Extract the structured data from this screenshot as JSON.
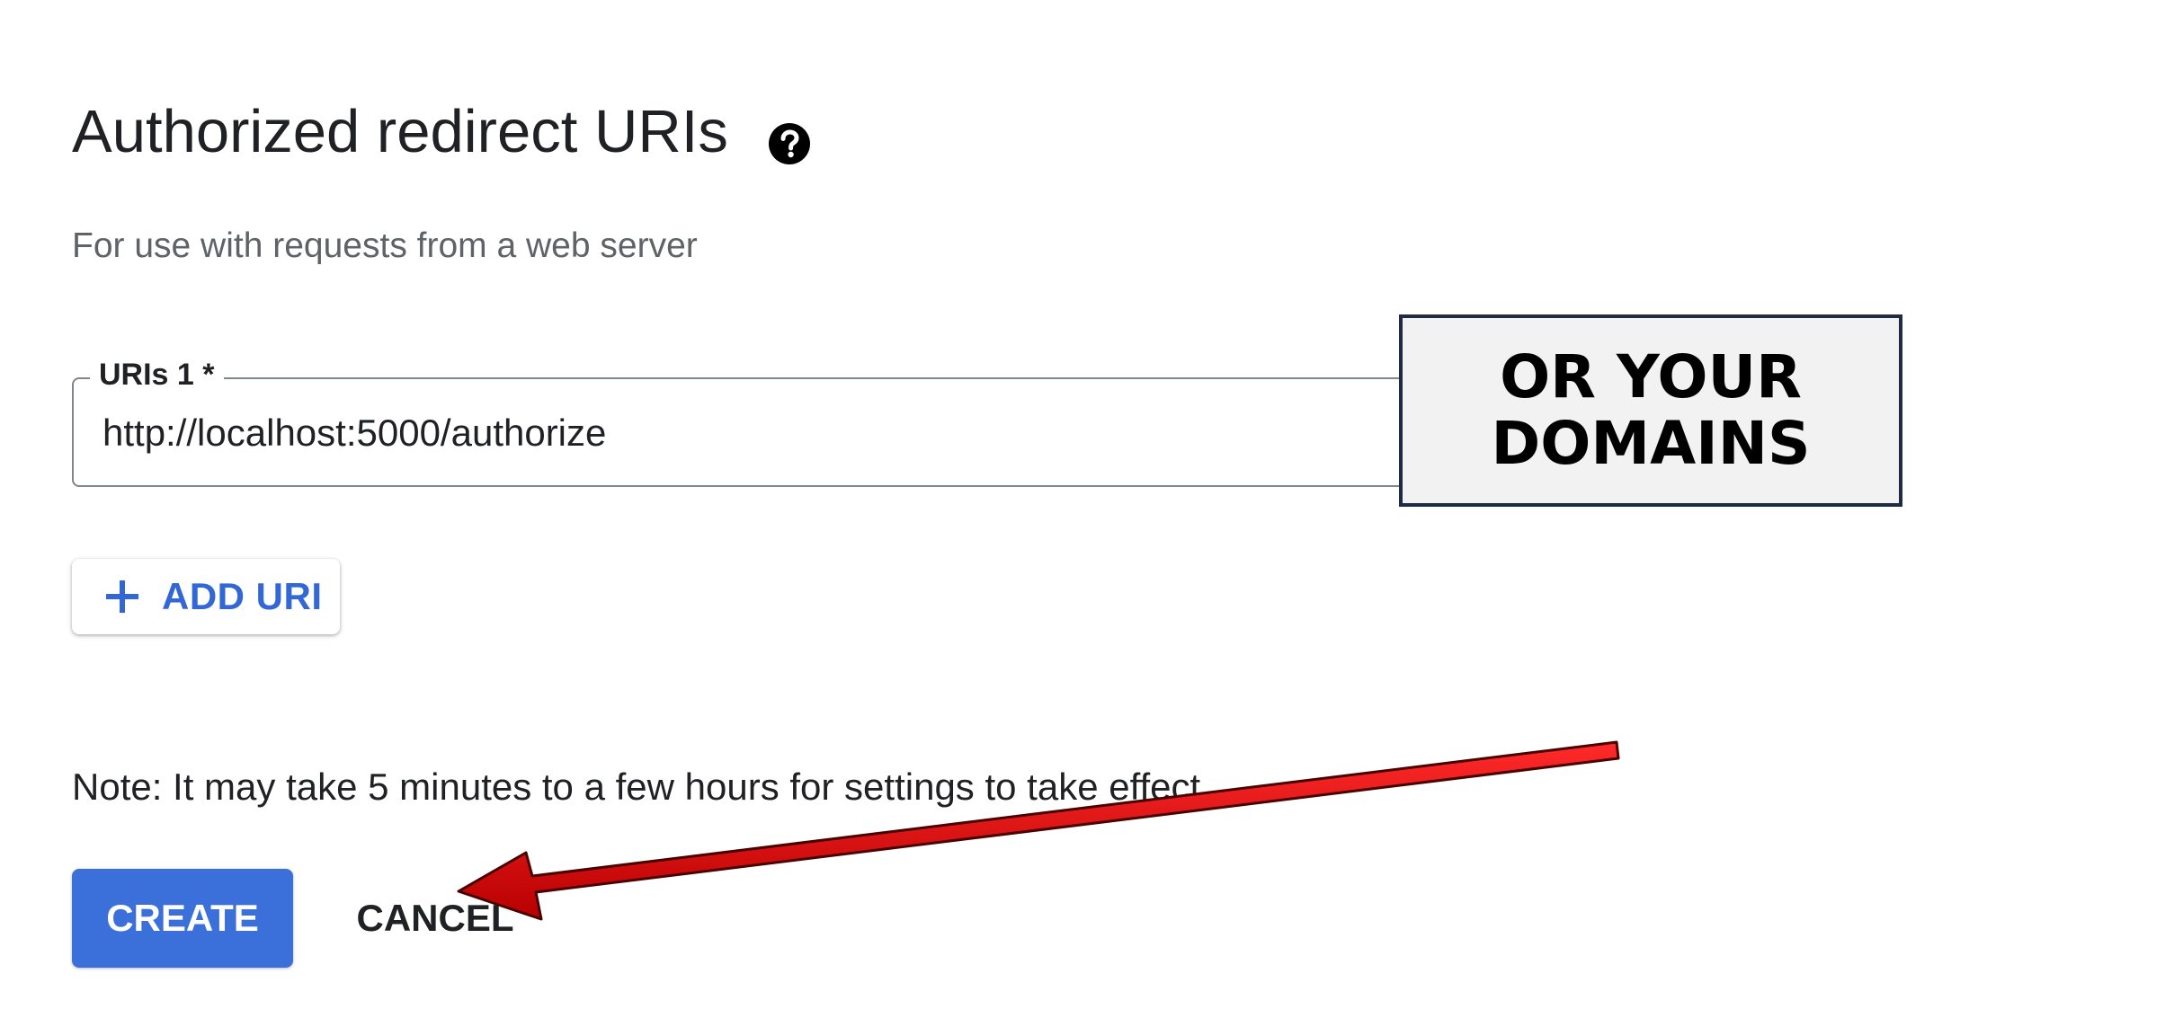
{
  "section": {
    "title": "Authorized redirect URIs",
    "help_icon": "help-circle-icon",
    "subtitle": "For use with requests from a web server"
  },
  "uri_field": {
    "label": "URIs 1 *",
    "value": "http://localhost:5000/authorize"
  },
  "add_uri_button": {
    "icon": "plus-icon",
    "label": "ADD URI"
  },
  "note": "Note: It may take 5 minutes to a few hours for settings to take effect",
  "actions": {
    "create_label": "CREATE",
    "cancel_label": "CANCEL"
  },
  "annotation": {
    "callout_line1": "OR YOUR",
    "callout_line2": "DOMAINS",
    "arrow_color": "#e00000"
  },
  "colors": {
    "accent": "#3b6fd9",
    "link": "#3367d6"
  }
}
